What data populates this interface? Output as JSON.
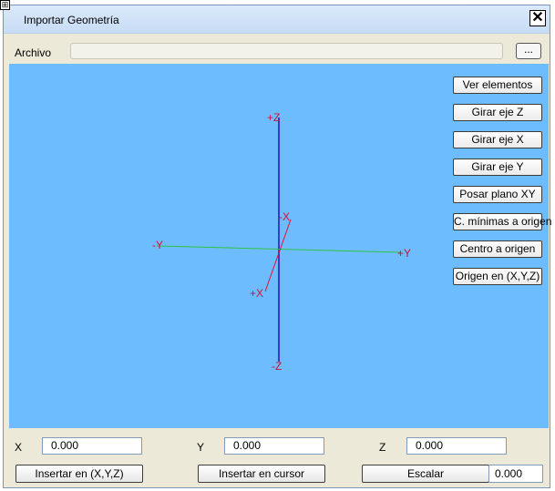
{
  "window": {
    "title": "Importar Geometría",
    "close_glyph": "✕",
    "corner_glyph": "⊞"
  },
  "file": {
    "label": "Archivo",
    "value": "",
    "browse_label": "..."
  },
  "viewport": {
    "background": "#6dbcfd",
    "axis_colors": {
      "z": "#3a3acd",
      "y": "#2ec43e",
      "x": "#e0103a"
    },
    "labels": {
      "plus_z": "+Z",
      "minus_z": "-Z",
      "plus_y": "+Y",
      "minus_y": "-Y",
      "plus_x": "+X",
      "minus_x": "-X"
    }
  },
  "side_buttons": [
    "Ver elementos",
    "Girar eje Z",
    "Girar eje X",
    "Girar eje Y",
    "Posar plano XY",
    "C. mínimas a origen",
    "Centro a origen",
    "Origen en (X,Y,Z)"
  ],
  "coords": {
    "x_label": "X",
    "x_value": "0.000",
    "y_label": "Y",
    "y_value": "0.000",
    "z_label": "Z",
    "z_value": "0.000"
  },
  "actions": {
    "insert_xyz": "Insertar en (X,Y,Z)",
    "insert_cursor": "Insertar en cursor",
    "scale": "Escalar",
    "scale_value": "0.000"
  }
}
